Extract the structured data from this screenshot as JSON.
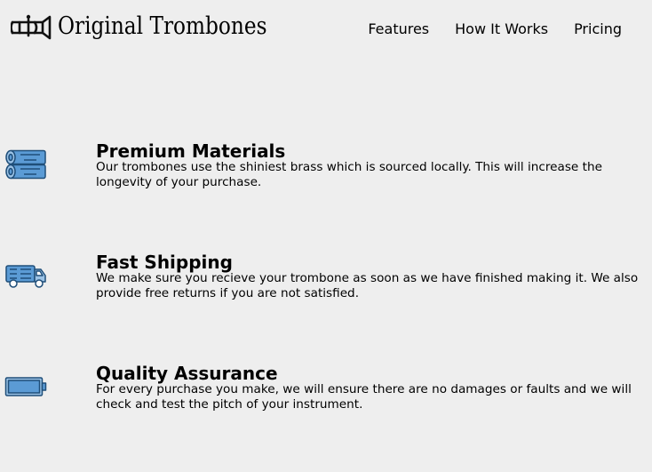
{
  "header": {
    "brand": "Original Trombones",
    "logo_icon": "trombone-icon",
    "nav": [
      {
        "label": "Features"
      },
      {
        "label": "How It Works"
      },
      {
        "label": "Pricing"
      }
    ]
  },
  "features": [
    {
      "icon": "brass-pipes-icon",
      "title": "Premium Materials",
      "description": "Our trombones use the shiniest brass which is sourced locally. This will increase the longevity of your purchase."
    },
    {
      "icon": "delivery-truck-icon",
      "title": "Fast Shipping",
      "description": "We make sure you recieve your trombone as soon as we have finished making it. We also provide free returns if you are not satisfied."
    },
    {
      "icon": "battery-icon",
      "title": "Quality Assurance",
      "description": "For every purchase you make, we will ensure there are no damages or faults and we will check and test the pitch of your instrument."
    }
  ],
  "colors": {
    "background": "#eeeeee",
    "icon_fill": "#5b9bd5",
    "icon_stroke": "#1f4e79"
  }
}
